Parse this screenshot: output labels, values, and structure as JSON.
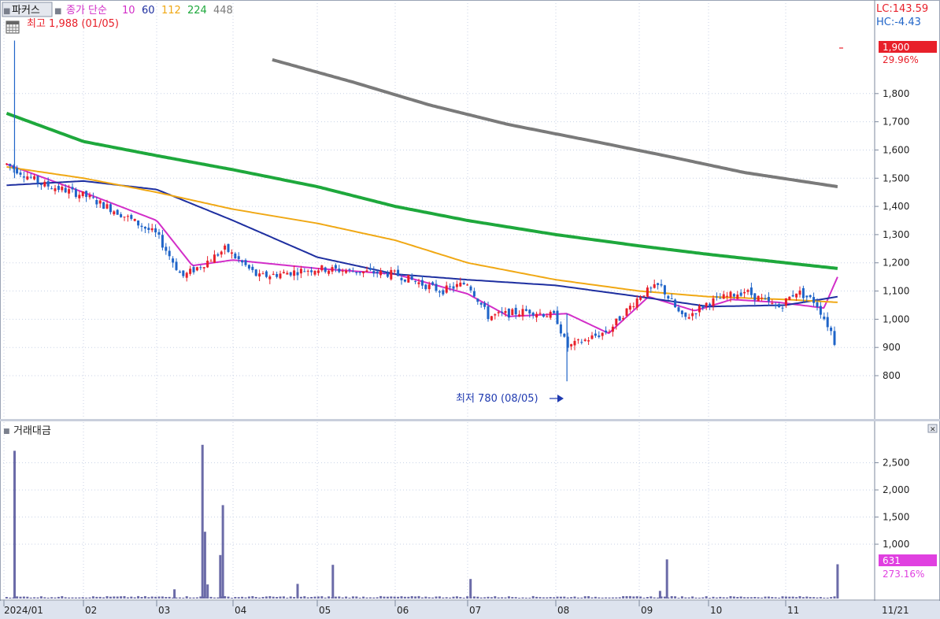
{
  "toolbar": {
    "label": "파커스",
    "ma_label": "종가 단순",
    "ma_periods": [
      "10",
      "60",
      "112",
      "224",
      "448"
    ]
  },
  "price_panel": {
    "high_annotation": "최고 1,988 (01/05)",
    "low_annotation": "최저 780 (08/05)",
    "lc_text": "LC:143.59",
    "hc_text": "HC:-4.43",
    "current_price_label": "1,900",
    "current_change_label": "29.96%"
  },
  "volume_panel": {
    "title": "거래대금",
    "current_value_label": "631",
    "current_change_label": "273.16%"
  },
  "colors": {
    "up": "#e8202a",
    "down": "#1f64c8",
    "ma10": "#d22ec8",
    "ma60": "#1e2fa0",
    "ma112": "#f0a814",
    "ma224": "#1ea83c",
    "ma448": "#7a7a7a",
    "volume_bar": "#6b6ba8",
    "grid": "#c8d2e6"
  },
  "chart_data": [
    {
      "type": "candlestick",
      "title": "",
      "y_ticks": [
        800,
        900,
        1000,
        1100,
        1200,
        1300,
        1400,
        1500,
        1600,
        1700,
        1800
      ],
      "y_tick_labels": [
        "800",
        "900",
        "1,000",
        "1,100",
        "1,200",
        "1,300",
        "1,400",
        "1,500",
        "1,600",
        "1,700",
        "1,800"
      ],
      "ylim": [
        680,
        2020
      ],
      "x_labels": [
        "2024/01",
        "02",
        "03",
        "04",
        "05",
        "06",
        "07",
        "08",
        "09",
        "10",
        "11",
        "11/21"
      ],
      "high": {
        "value": 1988,
        "date": "01/05"
      },
      "low": {
        "value": 780,
        "date": "08/05"
      },
      "last_close": 1900,
      "last_change_percent": 29.96,
      "price_path": [
        [
          "01/02",
          1550
        ],
        [
          "01/15",
          1480
        ],
        [
          "02/01",
          1440
        ],
        [
          "02/15",
          1380
        ],
        [
          "03/01",
          1300
        ],
        [
          "03/11",
          1150
        ],
        [
          "03/20",
          1200
        ],
        [
          "03/28",
          1250
        ],
        [
          "04/10",
          1150
        ],
        [
          "05/01",
          1180
        ],
        [
          "06/01",
          1160
        ],
        [
          "06/20",
          1100
        ],
        [
          "07/01",
          1130
        ],
        [
          "07/08",
          1010
        ],
        [
          "07/22",
          1030
        ],
        [
          "08/01",
          1010
        ],
        [
          "08/05",
          900
        ],
        [
          "08/20",
          960
        ],
        [
          "09/02",
          1090
        ],
        [
          "09/10",
          1120
        ],
        [
          "09/20",
          1000
        ],
        [
          "10/01",
          1060
        ],
        [
          "10/15",
          1100
        ],
        [
          "10/28",
          1040
        ],
        [
          "11/05",
          1100
        ],
        [
          "11/12",
          1060
        ],
        [
          "11/18",
          950
        ],
        [
          "11/20",
          880
        ]
      ],
      "moving_averages": [
        {
          "period": "10",
          "points": [
            [
              "01/02",
              1550
            ],
            [
              "02/01",
              1450
            ],
            [
              "03/01",
              1350
            ],
            [
              "03/15",
              1190
            ],
            [
              "04/01",
              1210
            ],
            [
              "05/01",
              1180
            ],
            [
              "06/01",
              1160
            ],
            [
              "07/01",
              1090
            ],
            [
              "07/15",
              1010
            ],
            [
              "08/05",
              1020
            ],
            [
              "08/20",
              950
            ],
            [
              "09/05",
              1080
            ],
            [
              "09/25",
              1030
            ],
            [
              "10/10",
              1070
            ],
            [
              "10/28",
              1060
            ],
            [
              "11/15",
              1040
            ],
            [
              "11/20",
              1150
            ]
          ]
        },
        {
          "period": "60",
          "points": [
            [
              "01/02",
              1475
            ],
            [
              "02/01",
              1490
            ],
            [
              "03/01",
              1460
            ],
            [
              "04/01",
              1350
            ],
            [
              "05/01",
              1220
            ],
            [
              "06/01",
              1160
            ],
            [
              "07/01",
              1140
            ],
            [
              "08/01",
              1120
            ],
            [
              "09/01",
              1080
            ],
            [
              "10/01",
              1045
            ],
            [
              "11/01",
              1050
            ],
            [
              "11/20",
              1080
            ]
          ]
        },
        {
          "period": "112",
          "points": [
            [
              "01/02",
              1540
            ],
            [
              "02/01",
              1500
            ],
            [
              "03/01",
              1450
            ],
            [
              "04/01",
              1390
            ],
            [
              "05/01",
              1340
            ],
            [
              "06/01",
              1280
            ],
            [
              "07/01",
              1200
            ],
            [
              "08/01",
              1140
            ],
            [
              "09/01",
              1100
            ],
            [
              "10/01",
              1080
            ],
            [
              "11/01",
              1070
            ],
            [
              "11/20",
              1060
            ]
          ]
        },
        {
          "period": "224",
          "points": [
            [
              "01/02",
              1730
            ],
            [
              "02/01",
              1630
            ],
            [
              "03/01",
              1580
            ],
            [
              "04/01",
              1530
            ],
            [
              "05/01",
              1470
            ],
            [
              "06/01",
              1400
            ],
            [
              "07/01",
              1350
            ],
            [
              "08/01",
              1300
            ],
            [
              "09/01",
              1260
            ],
            [
              "10/01",
              1230
            ],
            [
              "11/01",
              1200
            ],
            [
              "11/20",
              1180
            ]
          ]
        },
        {
          "period": "448",
          "points": [
            [
              "04/15",
              1920
            ],
            [
              "05/15",
              1840
            ],
            [
              "06/15",
              1760
            ],
            [
              "07/15",
              1690
            ],
            [
              "08/15",
              1630
            ],
            [
              "09/15",
              1575
            ],
            [
              "10/15",
              1520
            ],
            [
              "11/20",
              1470
            ]
          ]
        }
      ]
    },
    {
      "type": "bar",
      "title": "거래대금",
      "y_ticks": [
        1000,
        1500,
        2000,
        2500
      ],
      "y_tick_labels": [
        "1,000",
        "1,500",
        "2,000",
        "2,500"
      ],
      "ylim": [
        0,
        2900
      ],
      "last_value": 631,
      "last_change_percent": 273.16,
      "spikes": [
        {
          "date": "01/05",
          "value": 2720
        },
        {
          "date": "03/08",
          "value": 170
        },
        {
          "date": "03/19",
          "value": 2830
        },
        {
          "date": "03/20",
          "value": 1230
        },
        {
          "date": "03/21",
          "value": 260
        },
        {
          "date": "03/26",
          "value": 800
        },
        {
          "date": "03/27",
          "value": 1720
        },
        {
          "date": "04/24",
          "value": 270
        },
        {
          "date": "05/07",
          "value": 620
        },
        {
          "date": "07/02",
          "value": 360
        },
        {
          "date": "09/10",
          "value": 140
        },
        {
          "date": "09/13",
          "value": 720
        },
        {
          "date": "11/20",
          "value": 631
        }
      ]
    }
  ]
}
